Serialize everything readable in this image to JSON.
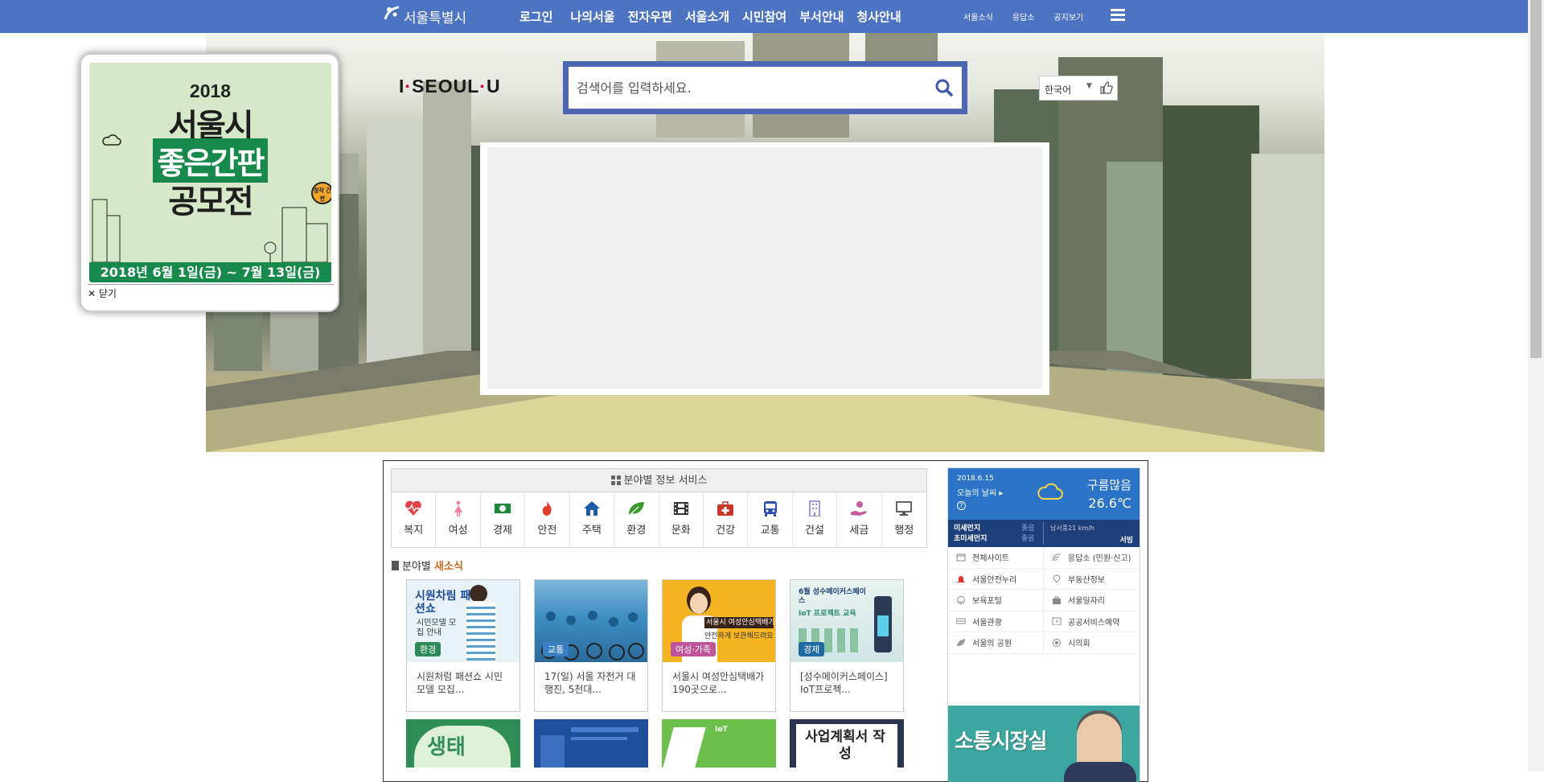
{
  "topnav": {
    "logo_text": "서울특별시",
    "menu": [
      "로그인",
      "나의서울",
      "전자우편",
      "서울소개",
      "시민참여",
      "부서안내",
      "청사안내"
    ],
    "util": [
      "서울소식",
      "응답소",
      "공지보기"
    ]
  },
  "hero": {
    "brand_left": "I",
    "brand_mid": "SEOUL",
    "brand_right": "U",
    "search_placeholder": "검색어를 입력하세요.",
    "language": "한국어"
  },
  "popup": {
    "year": "2018",
    "line1": "서울시",
    "line2": "좋은간판",
    "line3": "공모전",
    "badge": "창작 간판",
    "dates": "2018년 6월 1일(금) ~ 7월 13일(금)",
    "close_label": "닫기"
  },
  "services": {
    "title": "분야별 정보 서비스",
    "items": [
      {
        "label": "복지",
        "icon": "heart-pulse-icon",
        "color": "#e0434c"
      },
      {
        "label": "여성",
        "icon": "woman-icon",
        "color": "#f07fa0"
      },
      {
        "label": "경제",
        "icon": "money-icon",
        "color": "#1a8a3a"
      },
      {
        "label": "안전",
        "icon": "fire-icon",
        "color": "#e03a2a"
      },
      {
        "label": "주택",
        "icon": "house-icon",
        "color": "#1e5aa8"
      },
      {
        "label": "환경",
        "icon": "leaf-icon",
        "color": "#3a9a2a"
      },
      {
        "label": "문화",
        "icon": "film-icon",
        "color": "#333333"
      },
      {
        "label": "건강",
        "icon": "medkit-icon",
        "color": "#c9362a"
      },
      {
        "label": "교통",
        "icon": "bus-icon",
        "color": "#2a4fb0"
      },
      {
        "label": "건설",
        "icon": "building-icon",
        "color": "#8a7fd0"
      },
      {
        "label": "세금",
        "icon": "hand-coin-icon",
        "color": "#c45aa0"
      },
      {
        "label": "행정",
        "icon": "monitor-icon",
        "color": "#555555"
      }
    ]
  },
  "news": {
    "title_prefix": "분야별",
    "title_highlight": "새소식",
    "cards": [
      {
        "tag": "환경",
        "tag_color": "#2f8a5a",
        "caption": "시원처럼 패션쇼 시민모델 모집...",
        "img_title": "시원차림 패션쇼",
        "img_sub": "시민모델 모집 안내"
      },
      {
        "tag": "교통",
        "tag_color": "#3a7fc4",
        "caption": "17(일) 서울 자전거 대행진, 5천대...",
        "img_title": "",
        "img_sub": ""
      },
      {
        "tag": "여성·가족",
        "tag_color": "#c0549a",
        "caption": "서울시 여성안심택배가 190곳으로...",
        "img_title": "서울시 여성안심택배가",
        "img_sub": "안전하게 보관해드려요"
      },
      {
        "tag": "경제",
        "tag_color": "#1f6aa0",
        "caption": "[성수메이커스페이스] IoT프로젝...",
        "img_title": "6월 성수메이커스페이스",
        "img_sub": "IoT 프로젝트 교육"
      }
    ],
    "row2": [
      "생태",
      "",
      "IoT",
      "사업계획서 작성"
    ]
  },
  "weather": {
    "date": "2018.6.15",
    "today": "오늘의 날씨 ▸",
    "condition": "구름많음",
    "temperature": "26.6℃",
    "dust_label": "미세먼지",
    "dust_value": "좋음",
    "fine_dust_label": "초미세먼지",
    "fine_dust_value": "좋음",
    "wind": "남서풍21 km/h",
    "district": "서빙"
  },
  "quick_links": [
    [
      "전체사이트",
      "응답소 (민원·신고)"
    ],
    [
      "서울안전누리",
      "부동산정보"
    ],
    [
      "보육포털",
      "서울일자리"
    ],
    [
      "서울관광",
      "공공서비스예약"
    ],
    [
      "서울의 공원",
      "시의회"
    ]
  ],
  "promo": {
    "title": "소통시장실"
  },
  "colors": {
    "nav": "#4d73c3",
    "search_border": "#4d67b5",
    "weather": "#2b74c7",
    "popup_green": "#17894a"
  }
}
